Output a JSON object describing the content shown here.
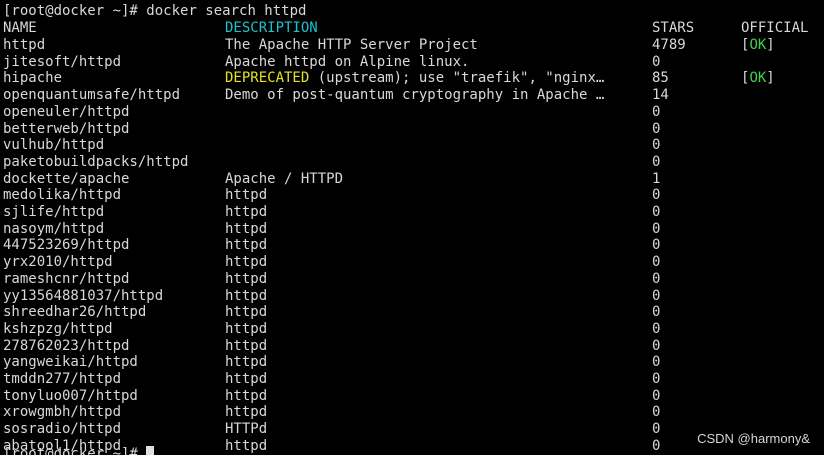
{
  "terminal": {
    "prompt": "[root@docker ~]# ",
    "command": "docker search httpd"
  },
  "headers": {
    "name": "NAME",
    "description": "DESCRIPTION",
    "stars": "STARS",
    "official": "OFFICIAL"
  },
  "colors": {
    "background": "#000000",
    "text": "#d8d8d8",
    "header_accent": "#19c3cf",
    "deprecated": "#e3e31e",
    "official_ok": "#3fd04a"
  },
  "results": [
    {
      "name": "httpd",
      "description": "The Apache HTTP Server Project",
      "stars": "4789",
      "official_prefix": "[",
      "official_ok": "OK",
      "official_suffix": "]"
    },
    {
      "name": "jitesoft/httpd",
      "description": "Apache httpd on Alpine linux.",
      "stars": "0"
    },
    {
      "name": "hipache",
      "description_flag": "DEPRECATED",
      "description": " (upstream); use \"traefik\", \"nginx…",
      "stars": "85",
      "official_prefix": "[",
      "official_ok": "OK",
      "official_suffix": "]"
    },
    {
      "name": "openquantumsafe/httpd",
      "description": "Demo of post-quantum cryptography in Apache …",
      "stars": "14"
    },
    {
      "name": "openeuler/httpd",
      "description": "",
      "stars": "0"
    },
    {
      "name": "betterweb/httpd",
      "description": "",
      "stars": "0"
    },
    {
      "name": "vulhub/httpd",
      "description": "",
      "stars": "0"
    },
    {
      "name": "paketobuildpacks/httpd",
      "description": "",
      "stars": "0"
    },
    {
      "name": "dockette/apache",
      "description": "Apache / HTTPD",
      "stars": "1"
    },
    {
      "name": "medolika/httpd",
      "description": "httpd",
      "stars": "0"
    },
    {
      "name": "sjlife/httpd",
      "description": "httpd",
      "stars": "0"
    },
    {
      "name": "nasoym/httpd",
      "description": "httpd",
      "stars": "0"
    },
    {
      "name": "447523269/httpd",
      "description": "httpd",
      "stars": "0"
    },
    {
      "name": "yrx2010/httpd",
      "description": "httpd",
      "stars": "0"
    },
    {
      "name": "rameshcnr/httpd",
      "description": "httpd",
      "stars": "0"
    },
    {
      "name": "yy13564881037/httpd",
      "description": "httpd",
      "stars": "0"
    },
    {
      "name": "shreedhar26/httpd",
      "description": "httpd",
      "stars": "0"
    },
    {
      "name": "kshzpzg/httpd",
      "description": "httpd",
      "stars": "0"
    },
    {
      "name": "278762023/httpd",
      "description": "httpd",
      "stars": "0"
    },
    {
      "name": "yangweikai/httpd",
      "description": "httpd",
      "stars": "0"
    },
    {
      "name": "tmddn277/httpd",
      "description": "httpd",
      "stars": "0"
    },
    {
      "name": "tonyluo007/httpd",
      "description": "httpd",
      "stars": "0"
    },
    {
      "name": "xrowgmbh/httpd",
      "description": "httpd",
      "stars": "0"
    },
    {
      "name": "sosradio/httpd",
      "description": "HTTPd",
      "stars": "0"
    },
    {
      "name": "abatool1/httpd",
      "description": "httpd",
      "stars": "0"
    }
  ],
  "watermark": "CSDN @harmony&"
}
